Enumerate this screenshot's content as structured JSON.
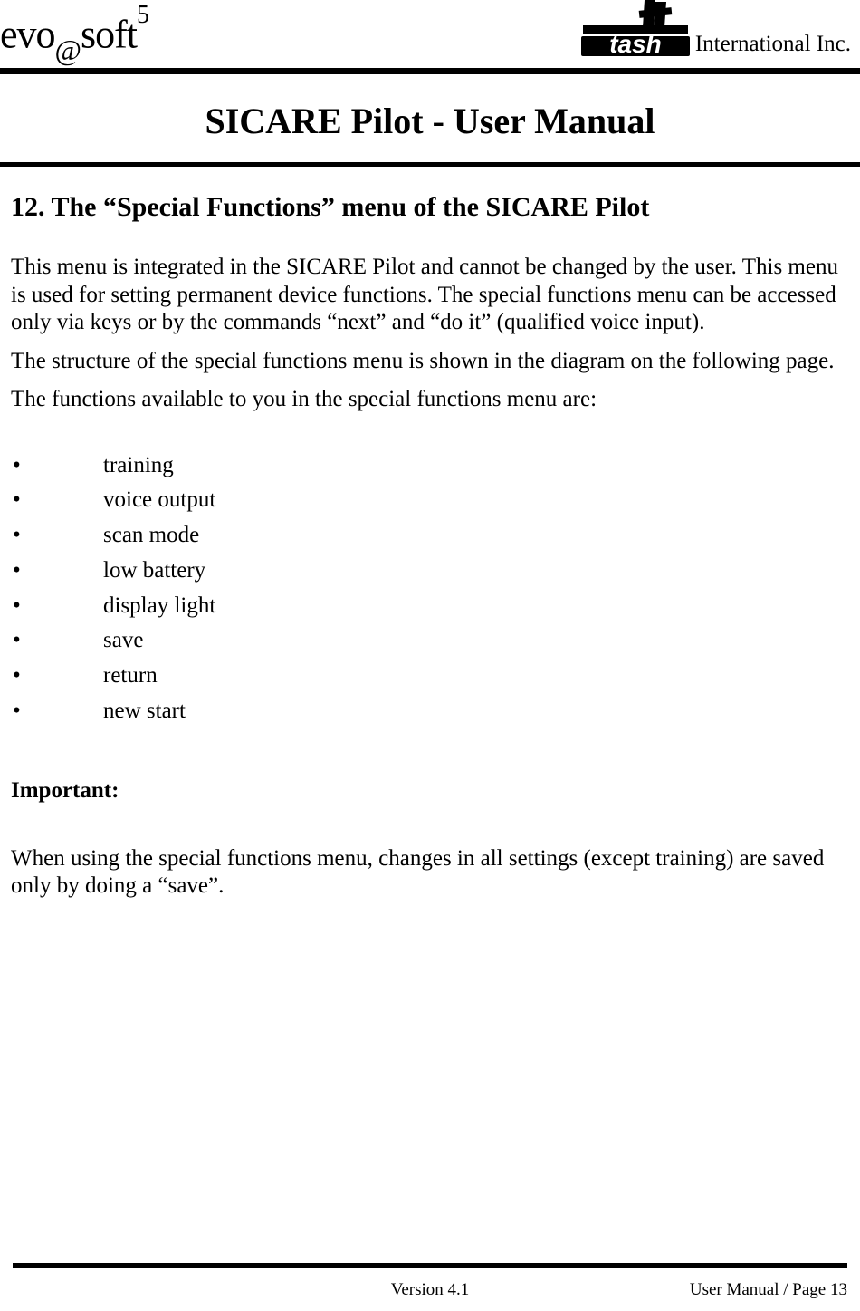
{
  "header": {
    "product_evo": "evo",
    "product_at": "@",
    "product_soft": "soft",
    "product_5": "5",
    "company": "International Inc."
  },
  "title": "SICARE Pilot - User Manual",
  "section": {
    "heading": "12.  The “Special Functions” menu of the SICARE Pilot",
    "para1": "This menu is integrated in the SICARE Pilot and cannot be changed by the user.  This menu is used for setting permanent device functions.  The special functions menu can be accessed only via keys or by the commands “next” and “do it” (qualified voice input).",
    "para2": "The structure of the special functions menu is shown in the diagram on the following page.",
    "para3": "The functions available to you in the special functions menu are:",
    "bullets": [
      "training",
      "voice output",
      "scan mode",
      "low battery",
      "display light",
      "save",
      "return",
      "new start"
    ],
    "important_label": "Important:",
    "important_text": "When using the special functions menu, changes in all settings (except training) are saved only by doing a “save”."
  },
  "footer": {
    "version": "Version 4.1",
    "page": "User Manual / Page 13"
  }
}
